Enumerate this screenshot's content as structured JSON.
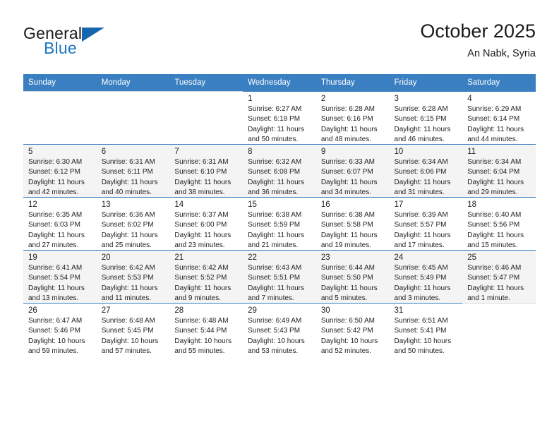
{
  "brand": {
    "name_top": "General",
    "name_bottom": "Blue",
    "accent_color": "#1f76c4",
    "triangle_color": "#1566ad"
  },
  "header": {
    "title": "October 2025",
    "subtitle": "An Nabk, Syria"
  },
  "calendar": {
    "header_bg": "#3a7fc1",
    "alt_row_bg": "#f4f4f4",
    "weekdays": [
      "Sunday",
      "Monday",
      "Tuesday",
      "Wednesday",
      "Thursday",
      "Friday",
      "Saturday"
    ],
    "weeks": [
      [
        {
          "day": "",
          "sunrise": "",
          "sunset": "",
          "daylight_line1": "",
          "daylight_line2": ""
        },
        {
          "day": "",
          "sunrise": "",
          "sunset": "",
          "daylight_line1": "",
          "daylight_line2": ""
        },
        {
          "day": "",
          "sunrise": "",
          "sunset": "",
          "daylight_line1": "",
          "daylight_line2": ""
        },
        {
          "day": "1",
          "sunrise": "Sunrise: 6:27 AM",
          "sunset": "Sunset: 6:18 PM",
          "daylight_line1": "Daylight: 11 hours",
          "daylight_line2": "and 50 minutes."
        },
        {
          "day": "2",
          "sunrise": "Sunrise: 6:28 AM",
          "sunset": "Sunset: 6:16 PM",
          "daylight_line1": "Daylight: 11 hours",
          "daylight_line2": "and 48 minutes."
        },
        {
          "day": "3",
          "sunrise": "Sunrise: 6:28 AM",
          "sunset": "Sunset: 6:15 PM",
          "daylight_line1": "Daylight: 11 hours",
          "daylight_line2": "and 46 minutes."
        },
        {
          "day": "4",
          "sunrise": "Sunrise: 6:29 AM",
          "sunset": "Sunset: 6:14 PM",
          "daylight_line1": "Daylight: 11 hours",
          "daylight_line2": "and 44 minutes."
        }
      ],
      [
        {
          "day": "5",
          "sunrise": "Sunrise: 6:30 AM",
          "sunset": "Sunset: 6:12 PM",
          "daylight_line1": "Daylight: 11 hours",
          "daylight_line2": "and 42 minutes."
        },
        {
          "day": "6",
          "sunrise": "Sunrise: 6:31 AM",
          "sunset": "Sunset: 6:11 PM",
          "daylight_line1": "Daylight: 11 hours",
          "daylight_line2": "and 40 minutes."
        },
        {
          "day": "7",
          "sunrise": "Sunrise: 6:31 AM",
          "sunset": "Sunset: 6:10 PM",
          "daylight_line1": "Daylight: 11 hours",
          "daylight_line2": "and 38 minutes."
        },
        {
          "day": "8",
          "sunrise": "Sunrise: 6:32 AM",
          "sunset": "Sunset: 6:08 PM",
          "daylight_line1": "Daylight: 11 hours",
          "daylight_line2": "and 36 minutes."
        },
        {
          "day": "9",
          "sunrise": "Sunrise: 6:33 AM",
          "sunset": "Sunset: 6:07 PM",
          "daylight_line1": "Daylight: 11 hours",
          "daylight_line2": "and 34 minutes."
        },
        {
          "day": "10",
          "sunrise": "Sunrise: 6:34 AM",
          "sunset": "Sunset: 6:06 PM",
          "daylight_line1": "Daylight: 11 hours",
          "daylight_line2": "and 31 minutes."
        },
        {
          "day": "11",
          "sunrise": "Sunrise: 6:34 AM",
          "sunset": "Sunset: 6:04 PM",
          "daylight_line1": "Daylight: 11 hours",
          "daylight_line2": "and 29 minutes."
        }
      ],
      [
        {
          "day": "12",
          "sunrise": "Sunrise: 6:35 AM",
          "sunset": "Sunset: 6:03 PM",
          "daylight_line1": "Daylight: 11 hours",
          "daylight_line2": "and 27 minutes."
        },
        {
          "day": "13",
          "sunrise": "Sunrise: 6:36 AM",
          "sunset": "Sunset: 6:02 PM",
          "daylight_line1": "Daylight: 11 hours",
          "daylight_line2": "and 25 minutes."
        },
        {
          "day": "14",
          "sunrise": "Sunrise: 6:37 AM",
          "sunset": "Sunset: 6:00 PM",
          "daylight_line1": "Daylight: 11 hours",
          "daylight_line2": "and 23 minutes."
        },
        {
          "day": "15",
          "sunrise": "Sunrise: 6:38 AM",
          "sunset": "Sunset: 5:59 PM",
          "daylight_line1": "Daylight: 11 hours",
          "daylight_line2": "and 21 minutes."
        },
        {
          "day": "16",
          "sunrise": "Sunrise: 6:38 AM",
          "sunset": "Sunset: 5:58 PM",
          "daylight_line1": "Daylight: 11 hours",
          "daylight_line2": "and 19 minutes."
        },
        {
          "day": "17",
          "sunrise": "Sunrise: 6:39 AM",
          "sunset": "Sunset: 5:57 PM",
          "daylight_line1": "Daylight: 11 hours",
          "daylight_line2": "and 17 minutes."
        },
        {
          "day": "18",
          "sunrise": "Sunrise: 6:40 AM",
          "sunset": "Sunset: 5:56 PM",
          "daylight_line1": "Daylight: 11 hours",
          "daylight_line2": "and 15 minutes."
        }
      ],
      [
        {
          "day": "19",
          "sunrise": "Sunrise: 6:41 AM",
          "sunset": "Sunset: 5:54 PM",
          "daylight_line1": "Daylight: 11 hours",
          "daylight_line2": "and 13 minutes."
        },
        {
          "day": "20",
          "sunrise": "Sunrise: 6:42 AM",
          "sunset": "Sunset: 5:53 PM",
          "daylight_line1": "Daylight: 11 hours",
          "daylight_line2": "and 11 minutes."
        },
        {
          "day": "21",
          "sunrise": "Sunrise: 6:42 AM",
          "sunset": "Sunset: 5:52 PM",
          "daylight_line1": "Daylight: 11 hours",
          "daylight_line2": "and 9 minutes."
        },
        {
          "day": "22",
          "sunrise": "Sunrise: 6:43 AM",
          "sunset": "Sunset: 5:51 PM",
          "daylight_line1": "Daylight: 11 hours",
          "daylight_line2": "and 7 minutes."
        },
        {
          "day": "23",
          "sunrise": "Sunrise: 6:44 AM",
          "sunset": "Sunset: 5:50 PM",
          "daylight_line1": "Daylight: 11 hours",
          "daylight_line2": "and 5 minutes."
        },
        {
          "day": "24",
          "sunrise": "Sunrise: 6:45 AM",
          "sunset": "Sunset: 5:49 PM",
          "daylight_line1": "Daylight: 11 hours",
          "daylight_line2": "and 3 minutes."
        },
        {
          "day": "25",
          "sunrise": "Sunrise: 6:46 AM",
          "sunset": "Sunset: 5:47 PM",
          "daylight_line1": "Daylight: 11 hours",
          "daylight_line2": "and 1 minute."
        }
      ],
      [
        {
          "day": "26",
          "sunrise": "Sunrise: 6:47 AM",
          "sunset": "Sunset: 5:46 PM",
          "daylight_line1": "Daylight: 10 hours",
          "daylight_line2": "and 59 minutes."
        },
        {
          "day": "27",
          "sunrise": "Sunrise: 6:48 AM",
          "sunset": "Sunset: 5:45 PM",
          "daylight_line1": "Daylight: 10 hours",
          "daylight_line2": "and 57 minutes."
        },
        {
          "day": "28",
          "sunrise": "Sunrise: 6:48 AM",
          "sunset": "Sunset: 5:44 PM",
          "daylight_line1": "Daylight: 10 hours",
          "daylight_line2": "and 55 minutes."
        },
        {
          "day": "29",
          "sunrise": "Sunrise: 6:49 AM",
          "sunset": "Sunset: 5:43 PM",
          "daylight_line1": "Daylight: 10 hours",
          "daylight_line2": "and 53 minutes."
        },
        {
          "day": "30",
          "sunrise": "Sunrise: 6:50 AM",
          "sunset": "Sunset: 5:42 PM",
          "daylight_line1": "Daylight: 10 hours",
          "daylight_line2": "and 52 minutes."
        },
        {
          "day": "31",
          "sunrise": "Sunrise: 6:51 AM",
          "sunset": "Sunset: 5:41 PM",
          "daylight_line1": "Daylight: 10 hours",
          "daylight_line2": "and 50 minutes."
        },
        {
          "day": "",
          "sunrise": "",
          "sunset": "",
          "daylight_line1": "",
          "daylight_line2": ""
        }
      ]
    ]
  }
}
